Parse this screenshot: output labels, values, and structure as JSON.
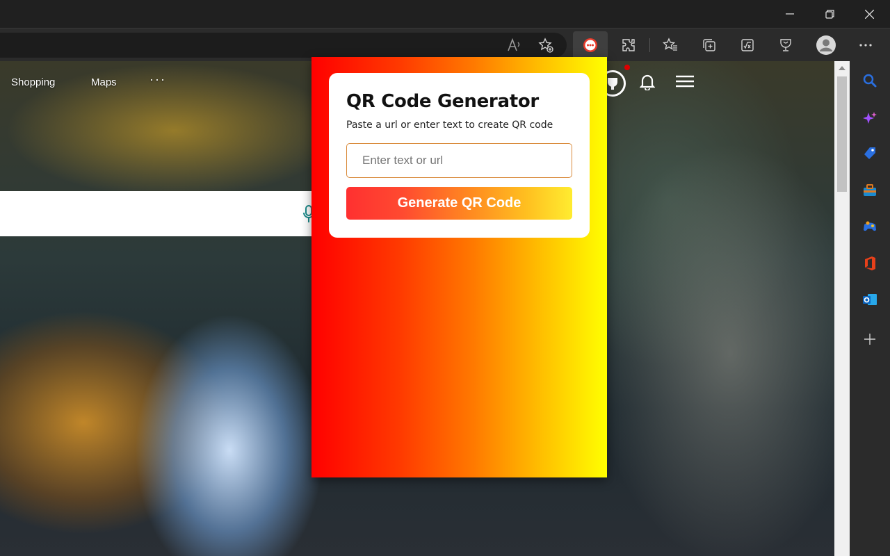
{
  "page": {
    "nav": [
      "Shopping",
      "Maps",
      "···"
    ]
  },
  "popup": {
    "title": "QR Code Generator",
    "subtitle": "Paste a url or enter text to create QR code",
    "input_placeholder": "Enter text or url",
    "button_label": "Generate QR Code",
    "gradient_colors": [
      "#ff0000",
      "#ff7a00",
      "#ffff00"
    ]
  },
  "toolbar": {
    "icons": [
      "read-aloud-icon",
      "add-favorite-icon",
      "qr-extension-icon",
      "extensions-icon",
      "favorites-icon",
      "collections-icon",
      "math-solver-icon",
      "browser-essentials-icon",
      "profile-icon",
      "more-icon"
    ]
  },
  "sidebar": {
    "icons": [
      "search-icon",
      "copilot-icon",
      "shopping-icon",
      "tools-icon",
      "games-icon",
      "office-icon",
      "outlook-icon",
      "add-icon"
    ]
  }
}
